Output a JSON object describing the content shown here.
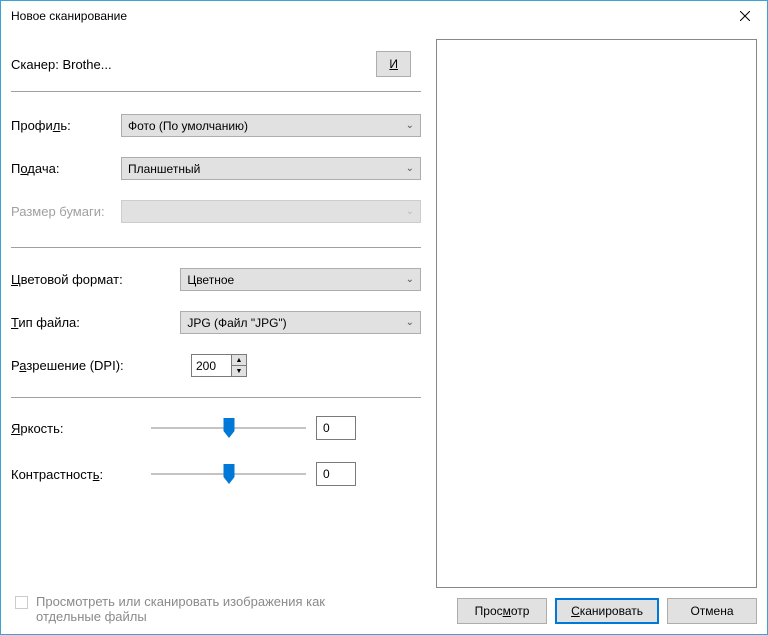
{
  "title": "Новое сканирование",
  "scanner": {
    "label": "Сканер: Brothe...",
    "change": "Изменить..."
  },
  "profile": {
    "label": "Профиль:",
    "value": "Фото (По умолчанию)"
  },
  "source": {
    "label": "Подача:",
    "value": "Планшетный"
  },
  "paper": {
    "label": "Размер бумаги:",
    "value": ""
  },
  "color": {
    "label": "Цветовой формат:",
    "value": "Цветное"
  },
  "filetype": {
    "label": "Тип файла:",
    "value": "JPG (Файл \"JPG\")"
  },
  "dpi": {
    "label": "Разрешение (DPI):",
    "value": "200"
  },
  "brightness": {
    "label": "Яркость:",
    "value": "0"
  },
  "contrast": {
    "label": "Контрастность:",
    "value": "0"
  },
  "separate": "Просмотреть или сканировать изображения как отдельные файлы",
  "buttons": {
    "preview": "Просмотр",
    "scan": "Сканировать",
    "cancel": "Отмена"
  }
}
